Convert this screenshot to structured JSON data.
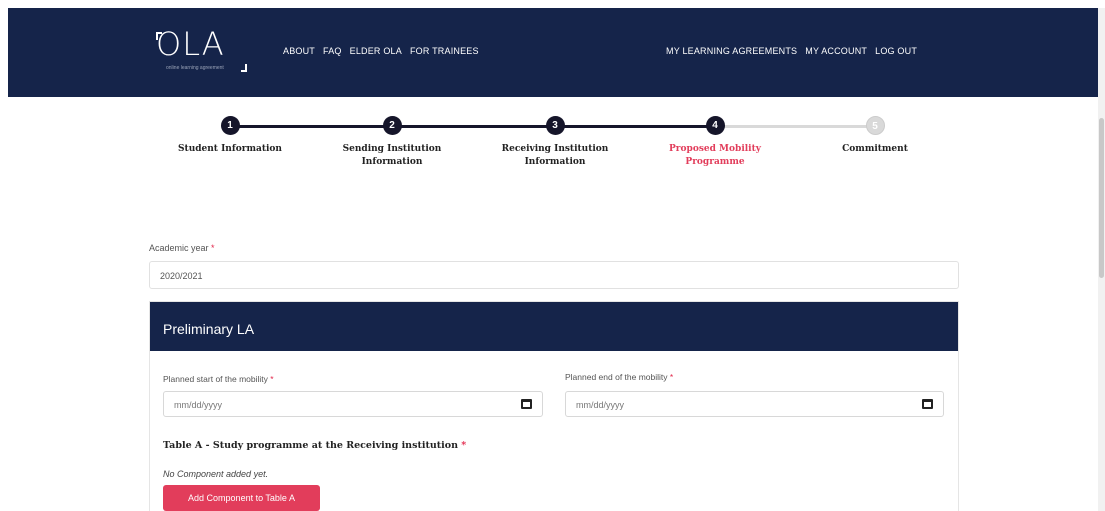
{
  "header": {
    "logo": {
      "mark": "OLA",
      "tagline": "online learning agreement"
    },
    "nav_left": [
      "ABOUT",
      "FAQ",
      "ELDER OLA",
      "FOR TRAINEES"
    ],
    "nav_right": [
      "MY LEARNING AGREEMENTS",
      "MY ACCOUNT",
      "LOG OUT"
    ]
  },
  "stepper": {
    "steps": [
      {
        "number": "1",
        "label_line1": "Student Information",
        "label_line2": ""
      },
      {
        "number": "2",
        "label_line1": "Sending Institution",
        "label_line2": "Information"
      },
      {
        "number": "3",
        "label_line1": "Receiving Institution",
        "label_line2": "Information"
      },
      {
        "number": "4",
        "label_line1": "Proposed Mobility",
        "label_line2": "Programme"
      },
      {
        "number": "5",
        "label_line1": "Commitment",
        "label_line2": ""
      }
    ],
    "active_step": 4,
    "colors": {
      "done": "#15152a",
      "active_label": "#e23d5b",
      "pending": "#d9d9d9"
    }
  },
  "form": {
    "academic_year_label": "Academic year",
    "required_mark": "*",
    "academic_year_value": "2020/2021",
    "card_title": "Preliminary LA",
    "start_label": "Planned start of the mobility",
    "end_label": "Planned end of the mobility",
    "date_placeholder": "mm/dd/yyyy",
    "table_a_title": "Table A - Study programme at the Receiving institution",
    "no_component_text": "No Component added yet.",
    "add_button_label": "Add Component to Table A"
  },
  "colors": {
    "navy": "#15244a",
    "accent": "#e23d5b"
  }
}
